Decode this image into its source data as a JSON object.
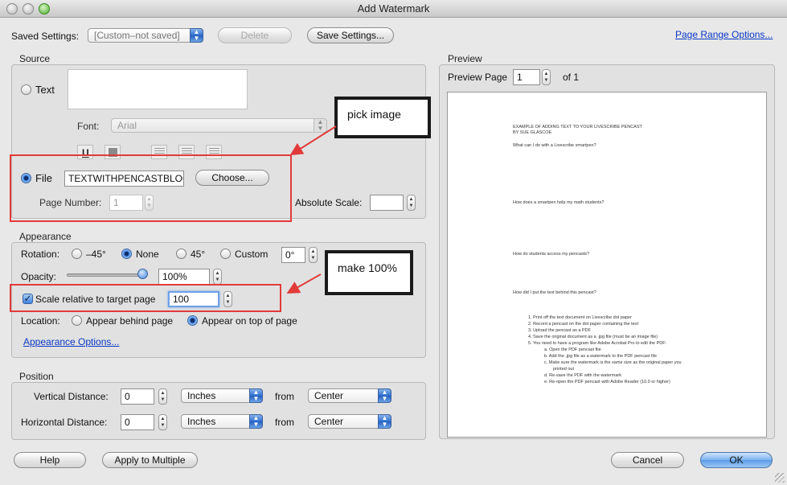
{
  "window": {
    "title": "Add Watermark"
  },
  "saved_settings": {
    "label": "Saved Settings:",
    "value": "[Custom–not saved]",
    "delete_label": "Delete",
    "save_label": "Save Settings..."
  },
  "page_range_link": "Page Range Options...",
  "source": {
    "title": "Source",
    "text_label": "Text",
    "font_label": "Font:",
    "font_value": "Arial",
    "file_label": "File",
    "file_value": "TEXTWITHPENCASTBLOG.jpg",
    "choose_label": "Choose...",
    "page_number_label": "Page Number:",
    "page_number_value": "1",
    "absolute_scale_label": "Absolute Scale:",
    "absolute_scale_value": ""
  },
  "appearance": {
    "title": "Appearance",
    "rotation_label": "Rotation:",
    "rot_neg45": "–45°",
    "rot_none": "None",
    "rot_45": "45°",
    "rot_custom": "Custom",
    "rot_custom_value": "0°",
    "opacity_label": "Opacity:",
    "opacity_value": "100%",
    "opacity_level": 1.0,
    "scale_label": "Scale relative to target page",
    "scale_value": "100",
    "location_label": "Location:",
    "loc_behind": "Appear behind page",
    "loc_top": "Appear on top of page",
    "options_link": "Appearance Options..."
  },
  "position": {
    "title": "Position",
    "vertical_label": "Vertical Distance:",
    "vertical_value": "0",
    "vertical_unit": "Inches",
    "vertical_from_label": "from",
    "vertical_from": "Center",
    "horizontal_label": "Horizontal Distance:",
    "horizontal_value": "0",
    "horizontal_unit": "Inches",
    "horizontal_from_label": "from",
    "horizontal_from": "Center"
  },
  "preview": {
    "title": "Preview",
    "page_label": "Preview Page",
    "page_value": "1",
    "of_label": "of 1",
    "doc": {
      "heading1": "EXAMPLE OF ADDING TEXT TO YOUR LIVESCRIBE PENCAST",
      "heading2": "BY SUE GLASCOE",
      "q1": "What can I do with a Livescribe smartpen?",
      "q2": "How does a smartpen help my math students?",
      "q3": "How do students access my pencasts?",
      "q4": "How did I put the text behind this pencast?",
      "steps": [
        "1.  Print off the text document on Livescribe dot paper",
        "2.  Record a pencast on the dot paper containing the text",
        "3.  Upload the pencast as a PDF",
        "4.  Save the original document as a .jpg file (must be an image file)",
        "5.  You need to have a program like Adobe Acrobat Pro to edit the PDF:",
        "a.   Open the PDF pencast file",
        "b.   Add the .jpg file as a watermark to the PDF pencast file",
        "c.   Make sure the watermark is the same size as the original paper you",
        "printed out",
        "d.   Re-save the PDF with the watermark",
        "e.   Re-open the PDF pencast with Adobe Reader (10.0 or higher)"
      ]
    }
  },
  "annotations": {
    "pick_image": "pick image",
    "make_100": "make 100%"
  },
  "footer": {
    "help_label": "Help",
    "apply_label": "Apply to Multiple",
    "cancel_label": "Cancel",
    "ok_label": "OK"
  },
  "colors": {
    "accent": "#3f84e0",
    "annotation_red": "#e23a3a",
    "link": "#0a37c4"
  }
}
